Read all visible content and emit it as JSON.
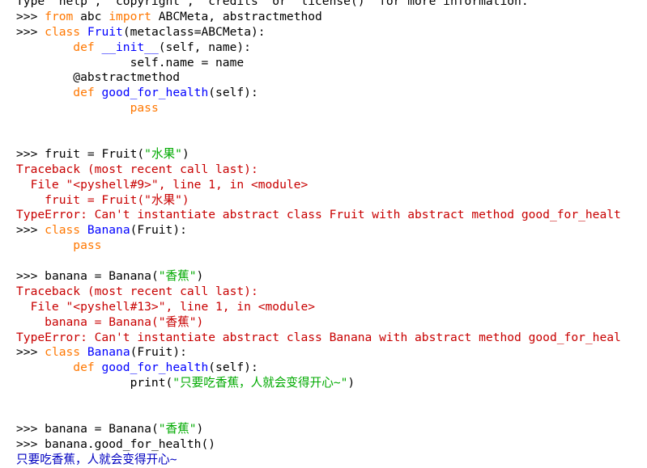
{
  "colors": {
    "keyword": "#ff7700",
    "definition": "#0000ff",
    "string": "#00aa00",
    "error": "#c80000",
    "output": "#0000c0",
    "text": "#000000",
    "background": "#ffffff"
  },
  "shell": {
    "lines": [
      {
        "kind": "partial",
        "segments": [
          {
            "t": "plain",
            "v": "Type \"help\", \"copyright\", \"credits\" or \"license()\" for more information."
          }
        ]
      },
      {
        "kind": "input",
        "segments": [
          {
            "t": "prompt",
            "v": ">>> "
          },
          {
            "t": "kw",
            "v": "from"
          },
          {
            "t": "plain",
            "v": " abc "
          },
          {
            "t": "kw",
            "v": "import"
          },
          {
            "t": "plain",
            "v": " ABCMeta, abstractmethod"
          }
        ]
      },
      {
        "kind": "input",
        "segments": [
          {
            "t": "prompt",
            "v": ">>> "
          },
          {
            "t": "kw",
            "v": "class"
          },
          {
            "t": "plain",
            "v": " "
          },
          {
            "t": "def",
            "v": "Fruit"
          },
          {
            "t": "plain",
            "v": "(metaclass=ABCMeta):"
          }
        ]
      },
      {
        "kind": "input",
        "segments": [
          {
            "t": "plain",
            "v": "        "
          },
          {
            "t": "kw",
            "v": "def"
          },
          {
            "t": "plain",
            "v": " "
          },
          {
            "t": "def",
            "v": "__init__"
          },
          {
            "t": "plain",
            "v": "(self, name):"
          }
        ]
      },
      {
        "kind": "input",
        "segments": [
          {
            "t": "plain",
            "v": "                self.name = name"
          }
        ]
      },
      {
        "kind": "input",
        "segments": [
          {
            "t": "plain",
            "v": "        @abstractmethod"
          }
        ]
      },
      {
        "kind": "input",
        "segments": [
          {
            "t": "plain",
            "v": "        "
          },
          {
            "t": "kw",
            "v": "def"
          },
          {
            "t": "plain",
            "v": " "
          },
          {
            "t": "def",
            "v": "good_for_health"
          },
          {
            "t": "plain",
            "v": "(self):"
          }
        ]
      },
      {
        "kind": "input",
        "segments": [
          {
            "t": "plain",
            "v": "                "
          },
          {
            "t": "kw",
            "v": "pass"
          }
        ]
      },
      {
        "kind": "blank",
        "segments": []
      },
      {
        "kind": "blank",
        "segments": []
      },
      {
        "kind": "input",
        "segments": [
          {
            "t": "prompt",
            "v": ">>> "
          },
          {
            "t": "plain",
            "v": "fruit = Fruit("
          },
          {
            "t": "str",
            "v": "\"水果\""
          },
          {
            "t": "plain",
            "v": ")"
          }
        ]
      },
      {
        "kind": "error",
        "segments": [
          {
            "t": "err",
            "v": "Traceback (most recent call last):"
          }
        ]
      },
      {
        "kind": "error",
        "segments": [
          {
            "t": "err",
            "v": "  File \"<pyshell#9>\", line 1, in <module>"
          }
        ]
      },
      {
        "kind": "error",
        "segments": [
          {
            "t": "err",
            "v": "    fruit = Fruit(\"水果\")"
          }
        ]
      },
      {
        "kind": "error",
        "segments": [
          {
            "t": "err",
            "v": "TypeError: Can't instantiate abstract class Fruit with abstract method good_for_healt"
          }
        ]
      },
      {
        "kind": "input",
        "segments": [
          {
            "t": "prompt",
            "v": ">>> "
          },
          {
            "t": "kw",
            "v": "class"
          },
          {
            "t": "plain",
            "v": " "
          },
          {
            "t": "def",
            "v": "Banana"
          },
          {
            "t": "plain",
            "v": "(Fruit):"
          }
        ]
      },
      {
        "kind": "input",
        "segments": [
          {
            "t": "plain",
            "v": "        "
          },
          {
            "t": "kw",
            "v": "pass"
          }
        ]
      },
      {
        "kind": "blank",
        "segments": []
      },
      {
        "kind": "input",
        "segments": [
          {
            "t": "prompt",
            "v": ">>> "
          },
          {
            "t": "plain",
            "v": "banana = Banana("
          },
          {
            "t": "str",
            "v": "\"香蕉\""
          },
          {
            "t": "plain",
            "v": ")"
          }
        ]
      },
      {
        "kind": "error",
        "segments": [
          {
            "t": "err",
            "v": "Traceback (most recent call last):"
          }
        ]
      },
      {
        "kind": "error",
        "segments": [
          {
            "t": "err",
            "v": "  File \"<pyshell#13>\", line 1, in <module>"
          }
        ]
      },
      {
        "kind": "error",
        "segments": [
          {
            "t": "err",
            "v": "    banana = Banana(\"香蕉\")"
          }
        ]
      },
      {
        "kind": "error",
        "segments": [
          {
            "t": "err",
            "v": "TypeError: Can't instantiate abstract class Banana with abstract method good_for_heal"
          }
        ]
      },
      {
        "kind": "input",
        "segments": [
          {
            "t": "prompt",
            "v": ">>> "
          },
          {
            "t": "kw",
            "v": "class"
          },
          {
            "t": "plain",
            "v": " "
          },
          {
            "t": "def",
            "v": "Banana"
          },
          {
            "t": "plain",
            "v": "(Fruit):"
          }
        ]
      },
      {
        "kind": "input",
        "segments": [
          {
            "t": "plain",
            "v": "        "
          },
          {
            "t": "kw",
            "v": "def"
          },
          {
            "t": "plain",
            "v": " "
          },
          {
            "t": "def",
            "v": "good_for_health"
          },
          {
            "t": "plain",
            "v": "(self):"
          }
        ]
      },
      {
        "kind": "input",
        "segments": [
          {
            "t": "plain",
            "v": "                print("
          },
          {
            "t": "str",
            "v": "\"只要吃香蕉，人就会变得开心~\""
          },
          {
            "t": "plain",
            "v": ")"
          }
        ]
      },
      {
        "kind": "blank",
        "segments": []
      },
      {
        "kind": "blank",
        "segments": []
      },
      {
        "kind": "input",
        "segments": [
          {
            "t": "prompt",
            "v": ">>> "
          },
          {
            "t": "plain",
            "v": "banana = Banana("
          },
          {
            "t": "str",
            "v": "\"香蕉\""
          },
          {
            "t": "plain",
            "v": ")"
          }
        ]
      },
      {
        "kind": "input",
        "segments": [
          {
            "t": "prompt",
            "v": ">>> "
          },
          {
            "t": "plain",
            "v": "banana.good_for_health()"
          }
        ]
      },
      {
        "kind": "output",
        "segments": [
          {
            "t": "out",
            "v": "只要吃香蕉，人就会变得开心~"
          }
        ]
      },
      {
        "kind": "input",
        "segments": [
          {
            "t": "prompt",
            "v": ">>> "
          }
        ]
      }
    ]
  }
}
